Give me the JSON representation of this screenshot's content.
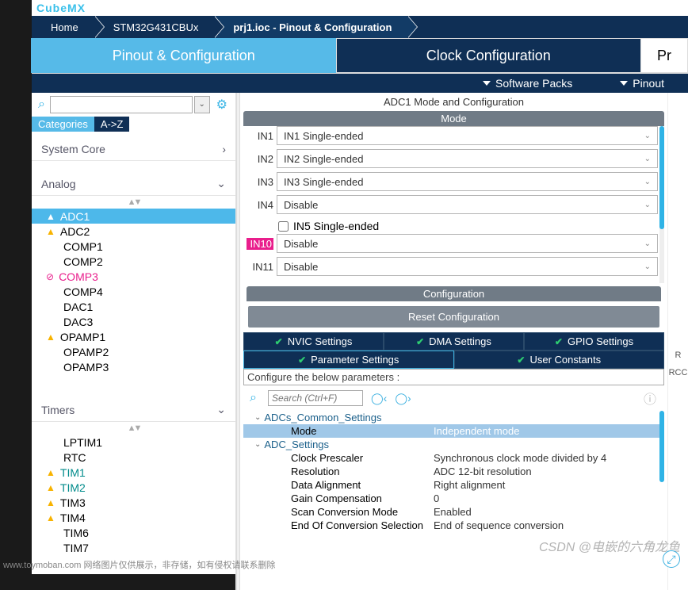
{
  "brand": "CubeMX",
  "breadcrumbs": [
    "Home",
    "STM32G431CBUx",
    "prj1.ioc - Pinout & Configuration"
  ],
  "tabs": {
    "pinout": "Pinout & Configuration",
    "clock": "Clock Configuration",
    "project": "Pr"
  },
  "subbar": {
    "packs": "Software Packs",
    "pinout": "Pinout"
  },
  "left_panel": {
    "tab_categories": "Categories",
    "tab_az": "A->Z",
    "groups": {
      "system": "System Core",
      "analog": "Analog",
      "timers": "Timers"
    },
    "analog_items": [
      "ADC1",
      "ADC2",
      "COMP1",
      "COMP2",
      "COMP3",
      "COMP4",
      "DAC1",
      "DAC3",
      "OPAMP1",
      "OPAMP2",
      "OPAMP3"
    ],
    "timer_items": [
      "LPTIM1",
      "RTC",
      "TIM1",
      "TIM2",
      "TIM3",
      "TIM4",
      "TIM6",
      "TIM7"
    ]
  },
  "right_panel": {
    "title": "ADC1 Mode and Configuration",
    "mode_head": "Mode",
    "ins": [
      {
        "label": "IN1",
        "value": "IN1 Single-ended"
      },
      {
        "label": "IN2",
        "value": "IN2 Single-ended"
      },
      {
        "label": "IN3",
        "value": "IN3 Single-ended"
      },
      {
        "label": "IN4",
        "value": "Disable"
      }
    ],
    "checkbox_label": "IN5 Single-ended",
    "in10": {
      "label": "IN10",
      "value": "Disable"
    },
    "in11": {
      "label": "IN11",
      "value": "Disable"
    },
    "config_head": "Configuration",
    "reset_btn": "Reset Configuration",
    "settings_tabs": [
      "NVIC Settings",
      "DMA Settings",
      "GPIO Settings",
      "Parameter Settings",
      "User Constants"
    ],
    "configure_label": "Configure the below parameters :",
    "search_placeholder": "Search (Ctrl+F)",
    "params": {
      "g1": "ADCs_Common_Settings",
      "g1_mode_k": "Mode",
      "g1_mode_v": "Independent mode",
      "g2": "ADC_Settings",
      "rows": [
        {
          "k": "Clock Prescaler",
          "v": "Synchronous clock mode divided by 4"
        },
        {
          "k": "Resolution",
          "v": "ADC 12-bit resolution"
        },
        {
          "k": "Data Alignment",
          "v": "Right alignment"
        },
        {
          "k": "Gain Compensation",
          "v": "0"
        },
        {
          "k": "Scan Conversion Mode",
          "v": "Enabled"
        },
        {
          "k": "End Of Conversion Selection",
          "v": "End of sequence conversion"
        }
      ]
    }
  },
  "right_strip": [
    "R",
    "RCC"
  ],
  "watermark": "www.toymoban.com 网络图片仅供展示，非存储，如有侵权请联系删除",
  "watermark2": "CSDN @电嵌的六角龙鱼"
}
